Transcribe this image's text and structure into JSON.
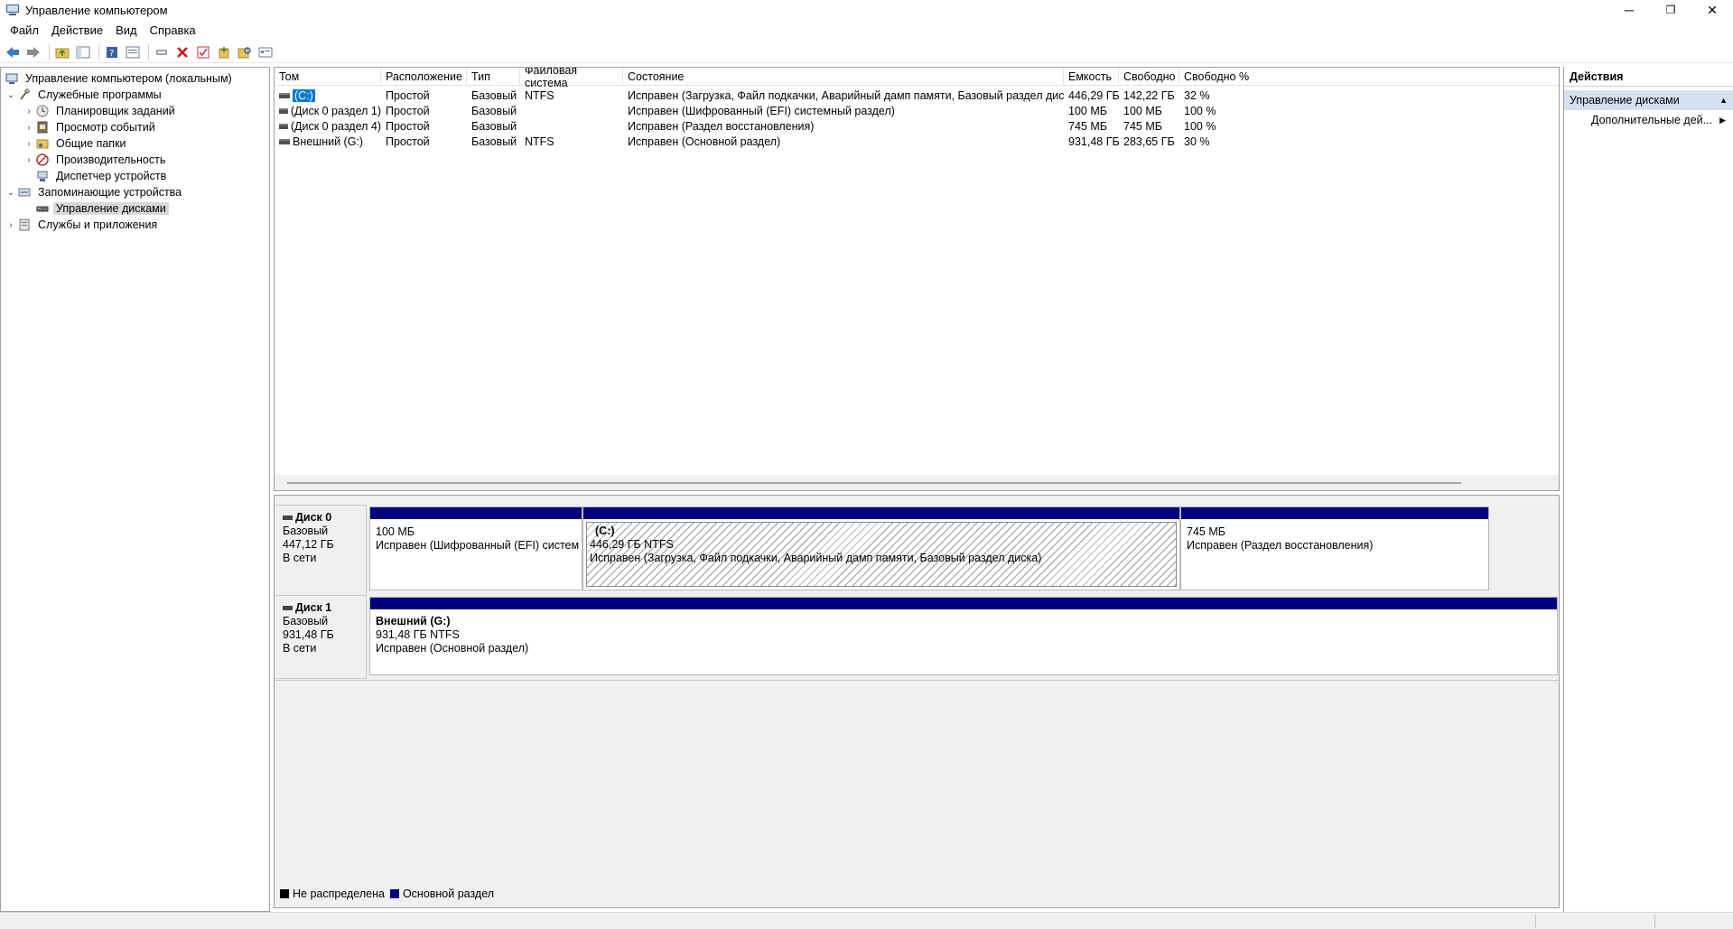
{
  "window": {
    "title": "Управление компьютером",
    "minimize_glyph": "─",
    "maximize_glyph": "❐",
    "close_glyph": "✕"
  },
  "menu": [
    "Файл",
    "Действие",
    "Вид",
    "Справка"
  ],
  "toolbar": {
    "icons": [
      "back-arrow-icon",
      "forward-arrow-icon",
      "up-folder-icon",
      "show-hide-tree-icon",
      "help-icon",
      "properties-icon",
      "connect-icon",
      "delete-icon",
      "check-icon",
      "new-icon",
      "search-icon",
      "settings-icon"
    ]
  },
  "tree": {
    "root": "Управление компьютером (локальным)",
    "system_tools": "Служебные программы",
    "task_scheduler": "Планировщик заданий",
    "event_viewer": "Просмотр событий",
    "shared_folders": "Общие папки",
    "performance": "Производительность",
    "device_manager": "Диспетчер устройств",
    "storage": "Запоминающие устройства",
    "disk_management": "Управление дисками",
    "services_apps": "Службы и приложения",
    "expanded_glyph": "⌄",
    "collapsed_glyph": "›"
  },
  "volume_list": {
    "columns": [
      "Том",
      "Расположение",
      "Тип",
      "Файловая система",
      "Состояние",
      "Емкость",
      "Свободно",
      "Свободно %"
    ],
    "rows": [
      {
        "name": "(C:)",
        "layout": "Простой",
        "type": "Базовый",
        "fs": "NTFS",
        "status": "Исправен (Загрузка, Файл подкачки, Аварийный дамп памяти, Базовый раздел диска)",
        "capacity": "446,29 ГБ",
        "free": "142,22 ГБ",
        "free_pct": "32 %",
        "selected": true
      },
      {
        "name": "(Диск 0 раздел 1)",
        "layout": "Простой",
        "type": "Базовый",
        "fs": "",
        "status": "Исправен (Шифрованный (EFI) системный раздел)",
        "capacity": "100 МБ",
        "free": "100 МБ",
        "free_pct": "100 %",
        "selected": false
      },
      {
        "name": "(Диск 0 раздел 4)",
        "layout": "Простой",
        "type": "Базовый",
        "fs": "",
        "status": "Исправен (Раздел восстановления)",
        "capacity": "745 МБ",
        "free": "745 МБ",
        "free_pct": "100 %",
        "selected": false
      },
      {
        "name": "Внешний (G:)",
        "layout": "Простой",
        "type": "Базовый",
        "fs": "NTFS",
        "status": "Исправен (Основной раздел)",
        "capacity": "931,48 ГБ",
        "free": "283,65 ГБ",
        "free_pct": "30 %",
        "selected": false
      }
    ]
  },
  "disks": [
    {
      "name": "Диск 0",
      "type": "Базовый",
      "size": "447,12 ГБ",
      "state": "В сети",
      "partitions": [
        {
          "title": "",
          "size": "100 МБ",
          "status": "Исправен (Шифрованный (EFI) системн",
          "selected": false
        },
        {
          "title": "(C:)",
          "size": "446,29 ГБ NTFS",
          "status": "Исправен (Загрузка, Файл подкачки, Аварийный дамп памяти, Базовый раздел диска)",
          "selected": true
        },
        {
          "title": "",
          "size": "745 МБ",
          "status": "Исправен (Раздел восстановления)",
          "selected": false
        }
      ]
    },
    {
      "name": "Диск 1",
      "type": "Базовый",
      "size": "931,48 ГБ",
      "state": "В сети",
      "partitions": [
        {
          "title": "Внешний  (G:)",
          "size": "931,48 ГБ NTFS",
          "status": "Исправен (Основной раздел)",
          "selected": false
        }
      ]
    }
  ],
  "legend": {
    "unallocated": "Не распределена",
    "primary": "Основной раздел",
    "unallocated_color": "#000000",
    "primary_color": "#000080"
  },
  "actions": {
    "header": "Действия",
    "section": "Управление дисками",
    "more": "Дополнительные дей...",
    "section_glyph": "▲",
    "more_glyph": "▶"
  }
}
